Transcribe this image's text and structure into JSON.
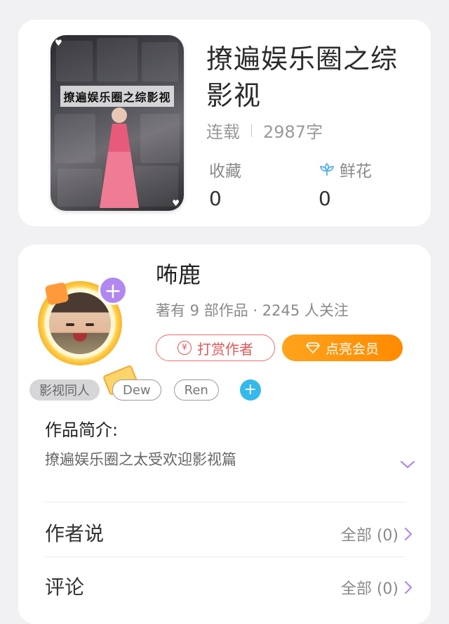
{
  "book": {
    "cover_title": "撩遍娱乐圈之综影视",
    "title": "撩遍娱乐圈之综影视",
    "status": "连载",
    "word_count": "2987字",
    "stats": {
      "favorites_label": "收藏",
      "favorites_value": "0",
      "flowers_label": "鲜花",
      "flowers_value": "0"
    }
  },
  "author": {
    "name": "咘鹿",
    "meta": "著有 9 部作品 · 2245 人关注",
    "follow_symbol": "+",
    "reward_icon": "¥",
    "reward_label": "打赏作者",
    "vip_label": "点亮会员"
  },
  "tags": {
    "items": [
      "影视同人",
      "Dew",
      "Ren"
    ],
    "add_symbol": "+"
  },
  "intro": {
    "title": "作品简介:",
    "text": "撩遍娱乐圈之太受欢迎影视篇"
  },
  "sections": {
    "author_says": {
      "label": "作者说",
      "value": "全部 (0)"
    },
    "comments": {
      "label": "评论",
      "value": "全部 (0)"
    }
  },
  "colors": {
    "accent_purple": "#b188f0",
    "reward_red": "#e45555",
    "vip_orange": "#ff8a00",
    "tag_blue": "#34b9ea"
  }
}
